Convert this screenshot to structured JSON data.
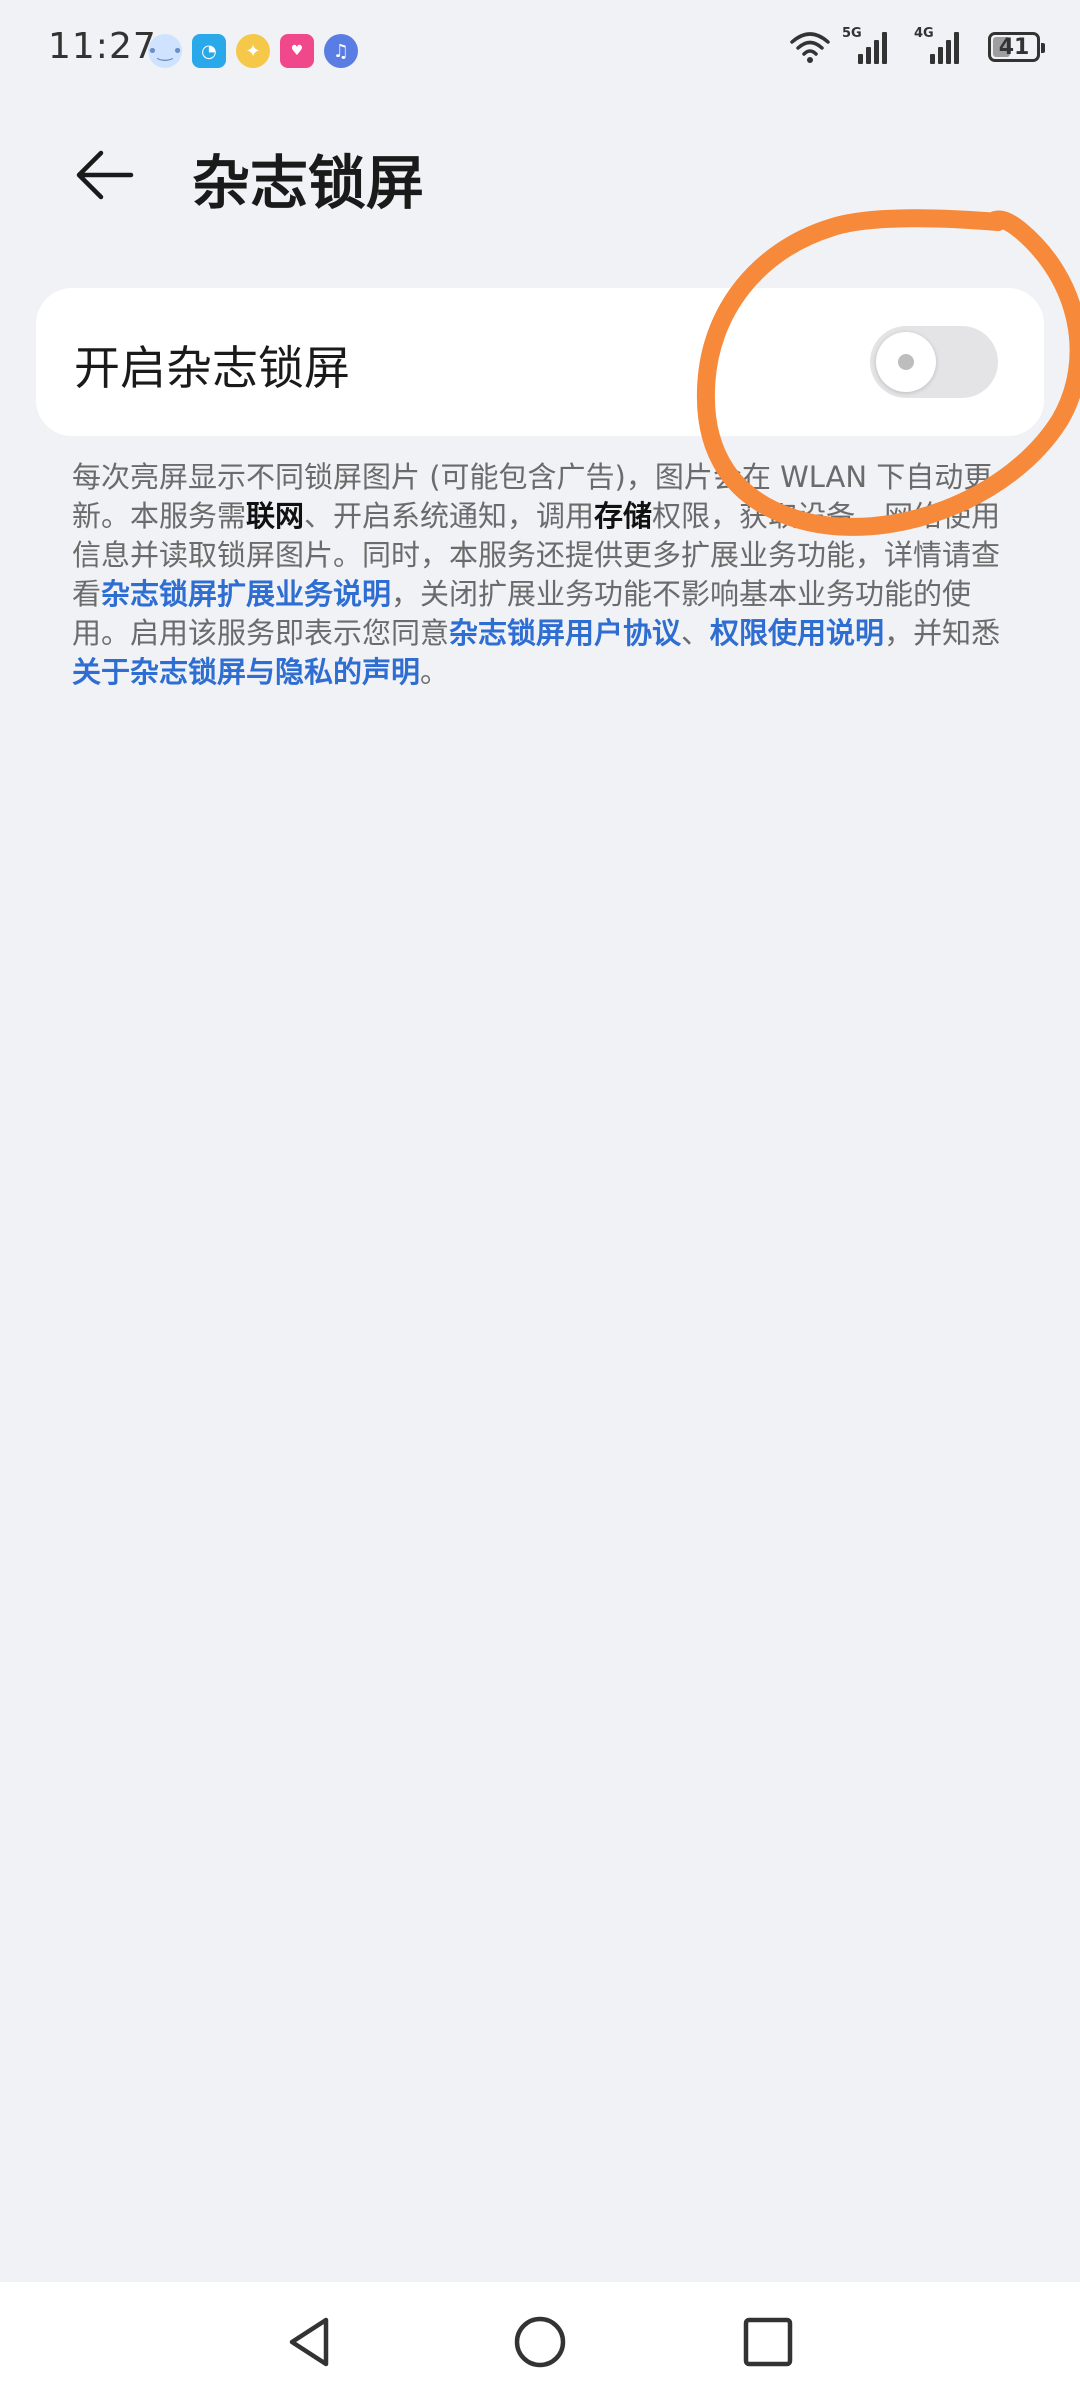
{
  "status_bar": {
    "time": "11:27",
    "network_1": "5G",
    "network_2": "4G",
    "battery_level": "41",
    "battery_fraction": 0.41,
    "notification_icons": [
      "chat-bot-icon",
      "browser-icon",
      "pinwheel-icon",
      "pink-app-icon",
      "music-icon"
    ]
  },
  "header": {
    "title": "杂志锁屏"
  },
  "setting": {
    "label": "开启杂志锁屏",
    "toggle_on": false
  },
  "description": {
    "t1": "每次亮屏显示不同锁屏图片 (可能包含广告)，图片会在 WLAN 下自动更新。本服务需",
    "b1": "联网",
    "t2": "、开启系统通知，调用",
    "b2": "存储",
    "t3": "权限，获取设备、网络使用信息并读取锁屏图片。同时，本服务还提供更多扩展业务功能，详情请查看",
    "l1": "杂志锁屏扩展业务说明",
    "t4": "，关闭扩展业务功能不影响基本业务功能的使用。启用该服务即表示您同意",
    "l2": "杂志锁屏用户协议",
    "t5": "、",
    "l3": "权限使用说明",
    "t6": "，并知悉",
    "l4": "关于杂志锁屏与隐私的声明",
    "t7": "。"
  },
  "colors": {
    "background": "#f1f2f6",
    "link": "#2e6dd1",
    "annotation": "#f7893a"
  },
  "nav": {
    "icons": [
      "back-triangle-icon",
      "home-circle-icon",
      "recents-square-icon"
    ]
  }
}
